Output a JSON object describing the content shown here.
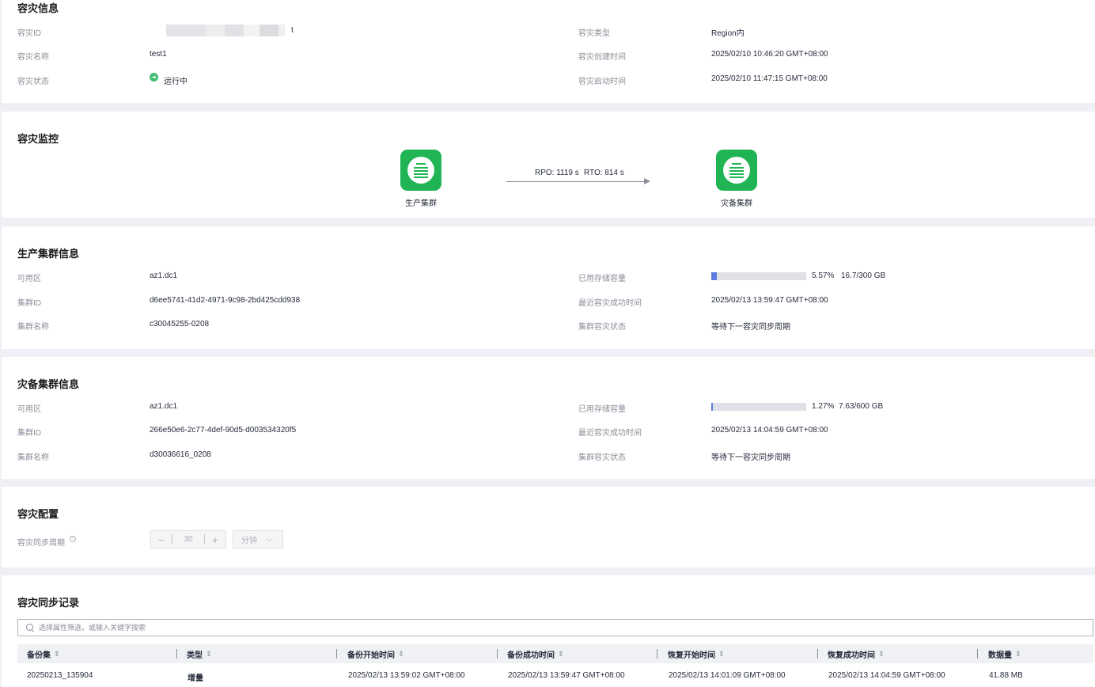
{
  "dr_info": {
    "title": "容灾信息",
    "labels": {
      "id": "容灾ID",
      "name": "容灾名称",
      "status": "容灾状态",
      "type": "容灾类型",
      "created": "容灾创建时间",
      "started": "容灾启动时间"
    },
    "values": {
      "id_suffix": "t",
      "name": "test1",
      "status": "运行中",
      "type": "Region内",
      "created": "2025/02/10 10:46:20 GMT+08:00",
      "started": "2025/02/10 11:47:15 GMT+08:00"
    },
    "status_color": "#3fba73"
  },
  "monitor": {
    "title": "容灾监控",
    "primary_cluster": "生产集群",
    "standby_cluster": "灾备集群",
    "rpo": "RPO: 1119 s",
    "rto": "RTO: 814 s",
    "icon": "cluster-icon",
    "icon_color": "#20b455"
  },
  "prod_cluster": {
    "title": "生产集群信息",
    "labels": {
      "az": "可用区",
      "cluster_id": "集群ID",
      "cluster_name": "集群名称",
      "storage": "已用存储容量",
      "last_success": "最近容灾成功时间",
      "dr_status": "集群容灾状态"
    },
    "values": {
      "az": "az1.dc1",
      "cluster_id": "d6ee5741-41d2-4971-9c98-2bd425cdd938",
      "cluster_name": "c30045255-0208",
      "storage_percent": "5.57%",
      "storage_amount": "16.7/300 GB",
      "storage_fraction": 0.0557,
      "last_success": "2025/02/13 13:59:47 GMT+08:00",
      "dr_status": "等待下一容灾同步周期"
    }
  },
  "dr_cluster": {
    "title": "灾备集群信息",
    "labels": {
      "az": "可用区",
      "cluster_id": "集群ID",
      "cluster_name": "集群名称",
      "storage": "已用存储容量",
      "last_success": "最近容灾成功时间",
      "dr_status": "集群容灾状态"
    },
    "values": {
      "az": "az1.dc1",
      "cluster_id": "266e50e6-2c77-4def-90d5-d003534320f5",
      "cluster_name": "d30036616_0208",
      "storage_percent": "1.27%",
      "storage_amount": "7.63/600 GB",
      "storage_fraction": 0.0127,
      "last_success": "2025/02/13 14:04:59 GMT+08:00",
      "dr_status": "等待下一容灾同步周期"
    }
  },
  "config": {
    "title": "容灾配置",
    "sync_period_label": "容灾同步周期",
    "help": "?",
    "minus": "−",
    "plus": "+",
    "value": "30",
    "unit": "分钟",
    "unit_chevron": "⌵"
  },
  "records": {
    "title": "容灾同步记录",
    "search_placeholder": "选择属性筛选，或输入关键字搜索",
    "sort_icon": "⇕",
    "columns": [
      "备份集",
      "类型",
      "备份开始时间",
      "备份成功时间",
      "恢复开始时间",
      "恢复成功时间",
      "数据量"
    ],
    "rows": [
      [
        "20250213_135904",
        "增量",
        "2025/02/13 13:59:02 GMT+08:00",
        "2025/02/13 13:59:47 GMT+08:00",
        "2025/02/13 14:01:09 GMT+08:00",
        "2025/02/13 14:04:59 GMT+08:00",
        "41.88 MB"
      ]
    ]
  }
}
